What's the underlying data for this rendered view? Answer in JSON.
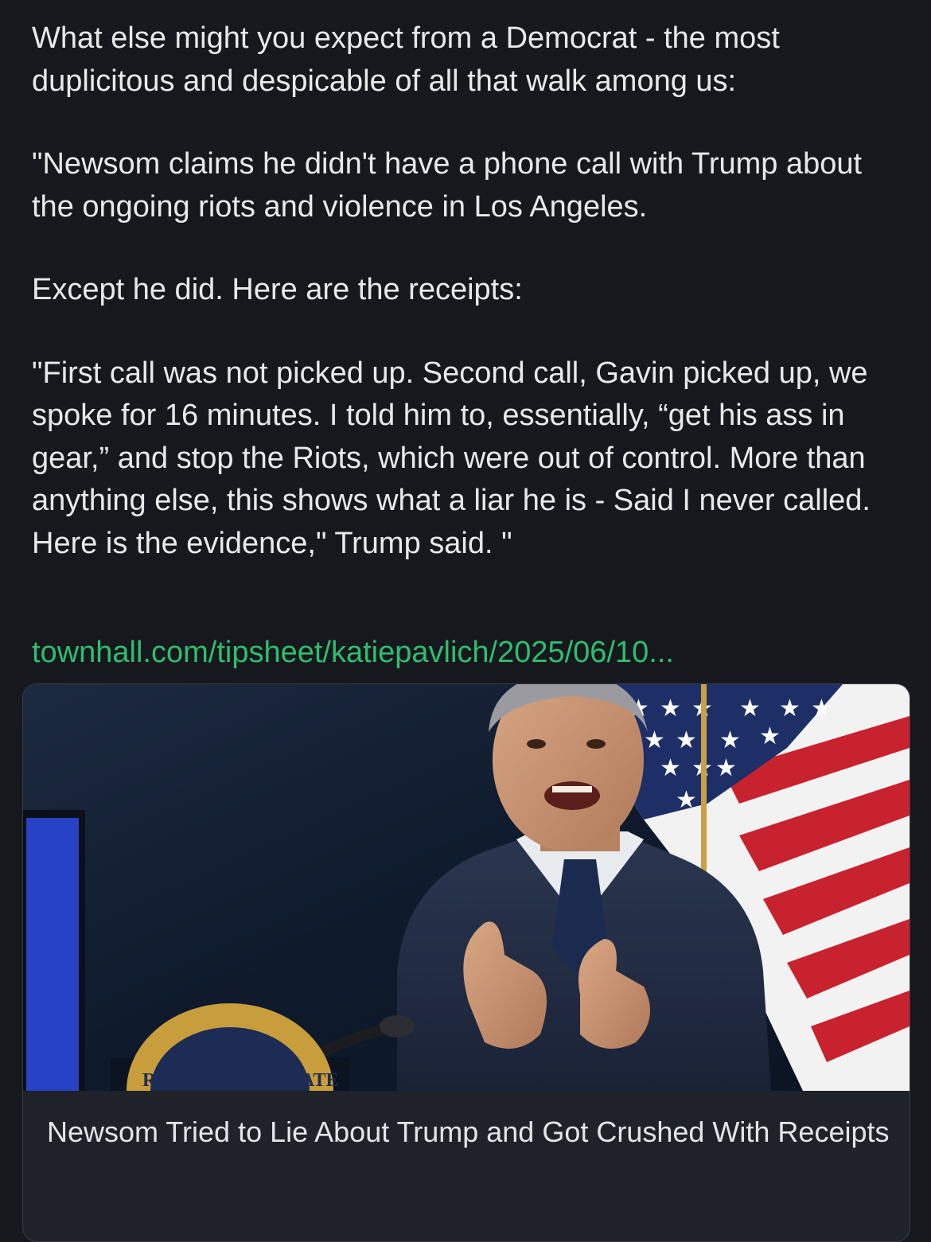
{
  "post": {
    "paragraphs": [
      "What else might you expect from a Democrat - the most duplicitous and despicable of all that walk among us:",
      "\"Newsom claims he didn't have a phone call with Trump about the ongoing riots and violence in Los Angeles.",
      "Except he did. Here are the receipts:",
      "\"First call was not picked up. Second call, Gavin picked up, we spoke for 16 minutes. I told him to, essentially, “get his ass in gear,” and stop the Riots, which were out of control. More than anything else, this shows what a liar he is - Said I never called. Here is the evidence,\" Trump said. \""
    ],
    "link_text": "townhall.com/tipsheet/katiepavlich/2025/06/10..."
  },
  "link_card": {
    "title": "Newsom Tried to Lie About Trump and Got Crushed With Receipts",
    "seal_text": "RNOR OF THE STATE"
  },
  "colors": {
    "background": "#16181d",
    "text": "#e7e9ea",
    "link": "#2fbd6f",
    "card_border": "#3a3d44"
  }
}
